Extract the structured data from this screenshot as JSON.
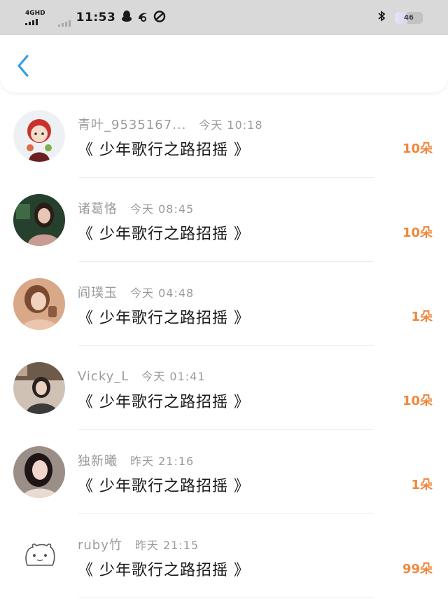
{
  "status_bar": {
    "network": "4GHD",
    "time": "11:53",
    "battery": "46"
  },
  "items": [
    {
      "name": "青叶_9535167...",
      "time": "今天 10:18",
      "title": "《 少年歌行之路招摇 》",
      "gift": "10朵"
    },
    {
      "name": "诸葛恪",
      "time": "今天 08:45",
      "title": "《 少年歌行之路招摇 》",
      "gift": "10朵"
    },
    {
      "name": "阎璞玉",
      "time": "今天 04:48",
      "title": "《 少年歌行之路招摇 》",
      "gift": "1朵"
    },
    {
      "name": "Vicky_L",
      "time": "今天 01:41",
      "title": "《 少年歌行之路招摇 》",
      "gift": "10朵"
    },
    {
      "name": "独新曦",
      "time": "昨天 21:16",
      "title": "《 少年歌行之路招摇 》",
      "gift": "1朵"
    },
    {
      "name": "ruby竹",
      "time": "昨天 21:15",
      "title": "《 少年歌行之路招摇 》",
      "gift": "99朵"
    }
  ]
}
